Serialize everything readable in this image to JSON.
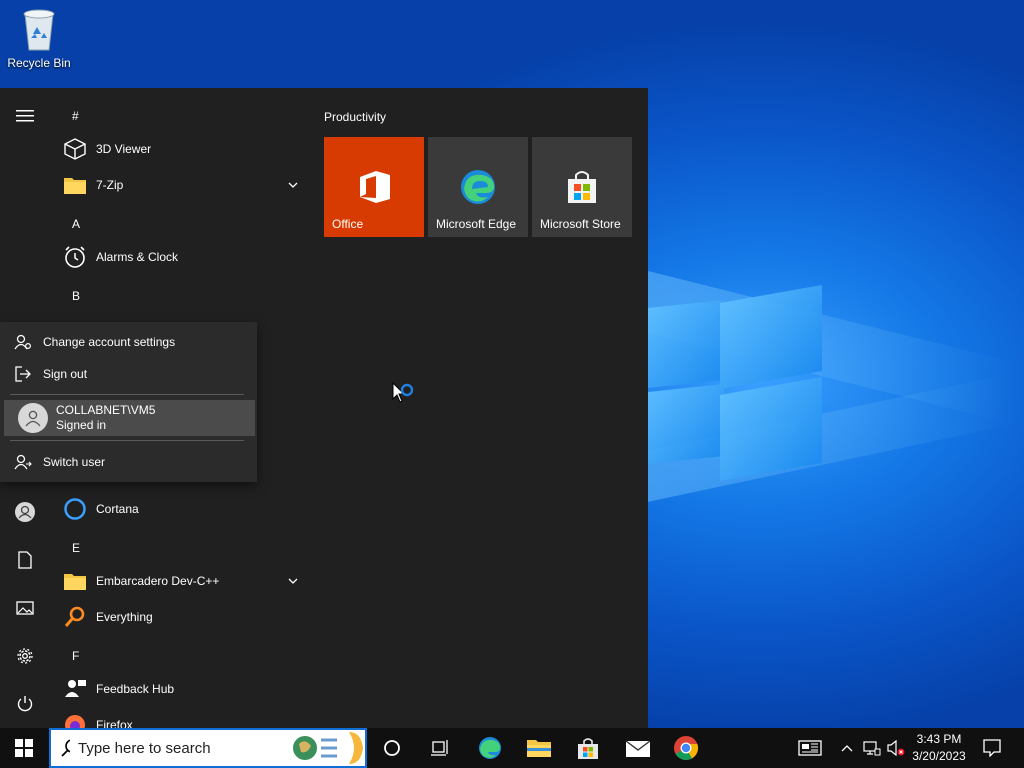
{
  "desktop": {
    "recycle_bin_label": "Recycle Bin"
  },
  "start_menu": {
    "app_list": [
      {
        "type": "header",
        "label": "#"
      },
      {
        "type": "app",
        "label": "3D Viewer",
        "icon": "cube-icon"
      },
      {
        "type": "app",
        "label": "7-Zip",
        "icon": "folder-icon",
        "expandable": true
      },
      {
        "type": "header",
        "label": "A"
      },
      {
        "type": "app",
        "label": "Alarms & Clock",
        "icon": "clock-icon"
      },
      {
        "type": "header",
        "label": "B"
      },
      {
        "type": "app",
        "label": "Cortana",
        "icon": "cortana-icon"
      },
      {
        "type": "header",
        "label": "E"
      },
      {
        "type": "app",
        "label": "Embarcadero Dev-C++",
        "icon": "folder-icon",
        "expandable": true
      },
      {
        "type": "app",
        "label": "Everything",
        "icon": "magnifier-icon"
      },
      {
        "type": "header",
        "label": "F"
      },
      {
        "type": "app",
        "label": "Feedback Hub",
        "icon": "feedback-icon"
      },
      {
        "type": "app",
        "label": "Firefox",
        "icon": "firefox-icon"
      }
    ],
    "tiles_group_title": "Productivity",
    "tiles": [
      {
        "label": "Office",
        "color": "#d83b01",
        "icon": "office-icon"
      },
      {
        "label": "Microsoft Edge",
        "color": "#3a3a3a",
        "icon": "edge-icon"
      },
      {
        "label": "Microsoft Store",
        "color": "#3a3a3a",
        "icon": "store-icon"
      }
    ]
  },
  "account_flyout": {
    "change_settings_label": "Change account settings",
    "sign_out_label": "Sign out",
    "user_name": "COLLABNET\\VM5",
    "user_status": "Signed in",
    "switch_user_label": "Switch user"
  },
  "taskbar": {
    "search_placeholder": "Type here to search",
    "time": "3:43 PM",
    "date": "3/20/2023"
  },
  "colors": {
    "start_bg": "#202020",
    "accent": "#0078d7",
    "office_tile": "#d83b01",
    "taskbar_bg": "#101010"
  }
}
